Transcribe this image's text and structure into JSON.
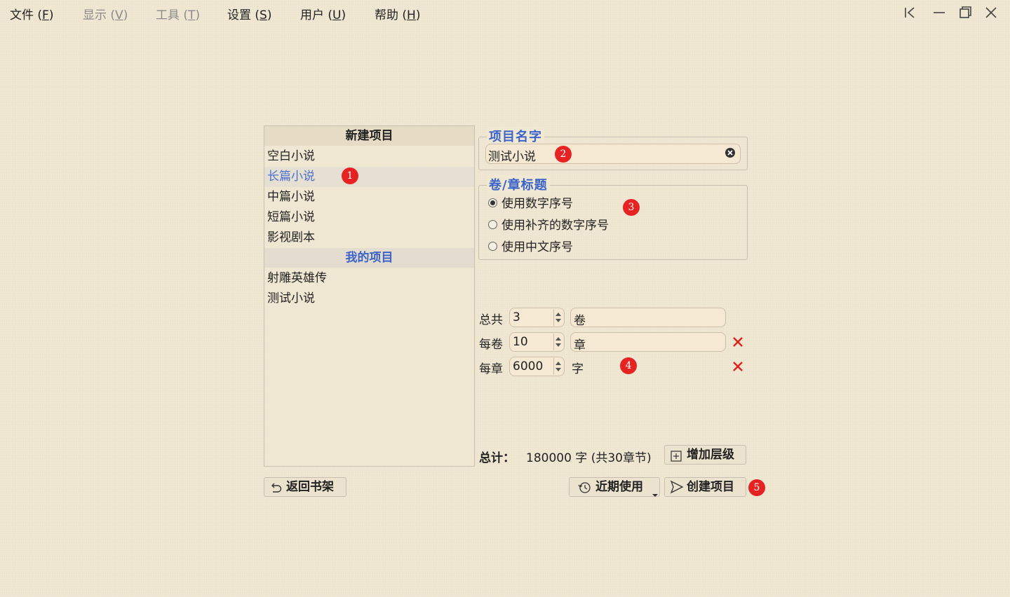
{
  "menubar": {
    "items": [
      {
        "label": "文件",
        "key": "F"
      },
      {
        "label": "显示",
        "key": "V"
      },
      {
        "label": "工具",
        "key": "T"
      },
      {
        "label": "设置",
        "key": "S"
      },
      {
        "label": "用户",
        "key": "U"
      },
      {
        "label": "帮助",
        "key": "H"
      }
    ]
  },
  "window_controls": [
    "collapse-sidebar-icon",
    "minimize-icon",
    "maximize-icon",
    "close-icon"
  ],
  "project_list": {
    "new_header": "新建项目",
    "templates": [
      "空白小说",
      "长篇小说",
      "中篇小说",
      "短篇小说",
      "影视剧本"
    ],
    "selected": "长篇小说",
    "mine_header": "我的项目",
    "my_projects": [
      "射雕英雄传",
      "测试小说"
    ]
  },
  "project_name": {
    "title": "项目名字",
    "value": "测试小说"
  },
  "heading_style": {
    "title": "卷/章标题",
    "options": [
      "使用数字序号",
      "使用补齐的数字序号",
      "使用中文序号"
    ],
    "selected": "使用数字序号"
  },
  "levels": [
    {
      "label": "总共",
      "value": "3",
      "unit": "卷"
    },
    {
      "label": "每卷",
      "value": "10",
      "unit": "章"
    },
    {
      "label": "每章",
      "value": "6000",
      "unit": "字"
    }
  ],
  "summary": {
    "label": "总计：",
    "value": "180000 字 (共30章节)"
  },
  "buttons": {
    "add_level": "增加层级",
    "back": "返回书架",
    "recent": "近期使用",
    "create": "创建项目"
  },
  "badges": [
    "1",
    "2",
    "3",
    "4",
    "5"
  ],
  "colors": {
    "accent": "#3c64c8",
    "badge": "#e62222",
    "background": "#f1e8d3",
    "delete": "#e02020"
  }
}
